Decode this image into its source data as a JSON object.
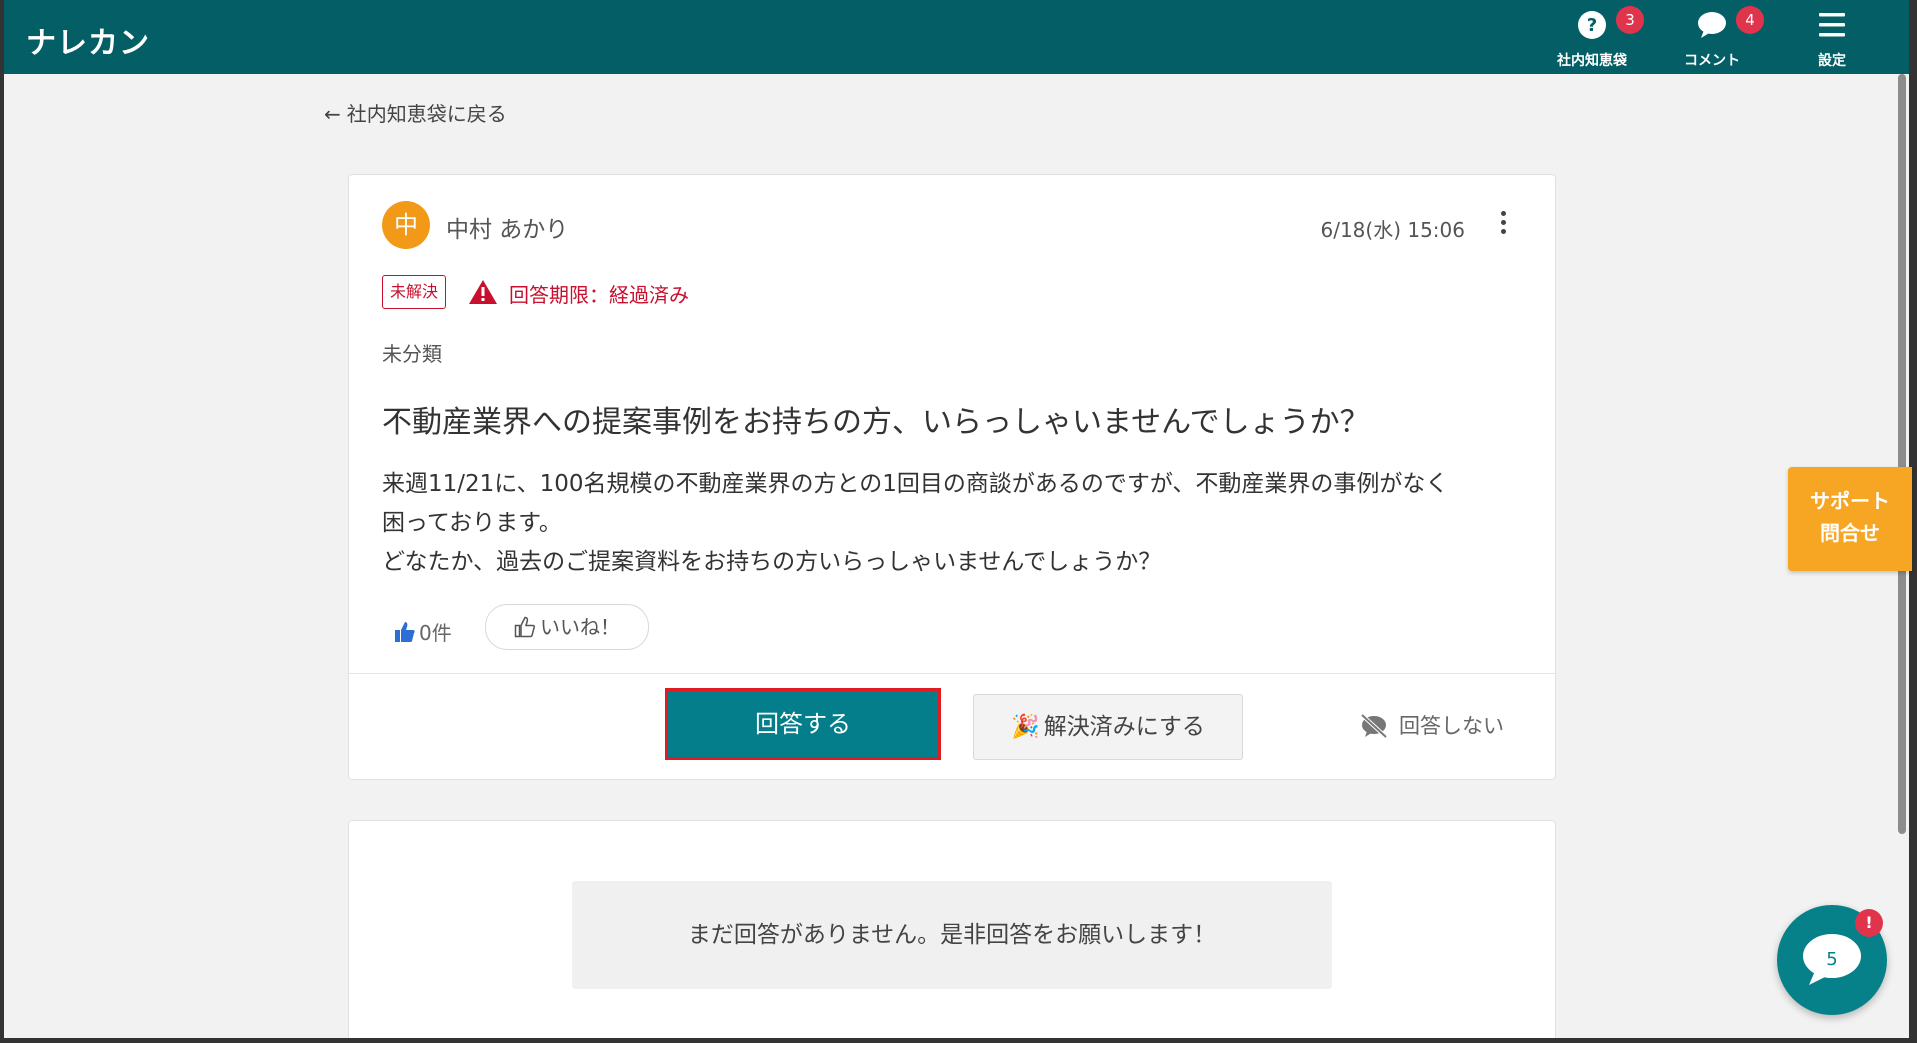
{
  "header": {
    "logo": "ナレカン",
    "items": [
      {
        "label": "社内知恵袋",
        "badge": "3",
        "icon": "question-circle-icon"
      },
      {
        "label": "コメント",
        "badge": "4",
        "icon": "speech-bubble-icon"
      },
      {
        "label": "設定",
        "badge": "",
        "icon": "hamburger-menu-icon"
      }
    ]
  },
  "back_link": "社内知恵袋に戻る",
  "post": {
    "avatar_initial": "中",
    "author": "中村 あかり",
    "date": "6/18(水) 15:06",
    "status": "未解決",
    "deadline": "回答期限：経過済み",
    "category": "未分類",
    "title": "不動産業界への提案事例をお持ちの方、いらっしゃいませんでしょうか？",
    "body_line1": "来週11/21に、100名規模の不動産業界の方との1回目の商談があるのですが、不動産業界の事例がなく",
    "body_line2": "困っております。",
    "body_line3": "どなたか、過去のご提案資料をお持ちの方いらっしゃいませんでしょうか？",
    "like_count": "0件",
    "like_button": "いいね！",
    "answer_button": "回答する",
    "resolve_button": "解決済みにする",
    "no_answer_button": "回答しない"
  },
  "answers": {
    "empty_message": "まだ回答がありません。是非回答をお願いします！"
  },
  "support": {
    "line1": "サポート",
    "line2": "問合せ"
  },
  "chat": {
    "count": "5",
    "alert": "!"
  },
  "colors": {
    "header_bg": "#035e66",
    "primary": "#047e8a",
    "danger": "#c8102e",
    "badge": "#e0344d",
    "avatar": "#f29a17",
    "support": "#f7a623"
  }
}
